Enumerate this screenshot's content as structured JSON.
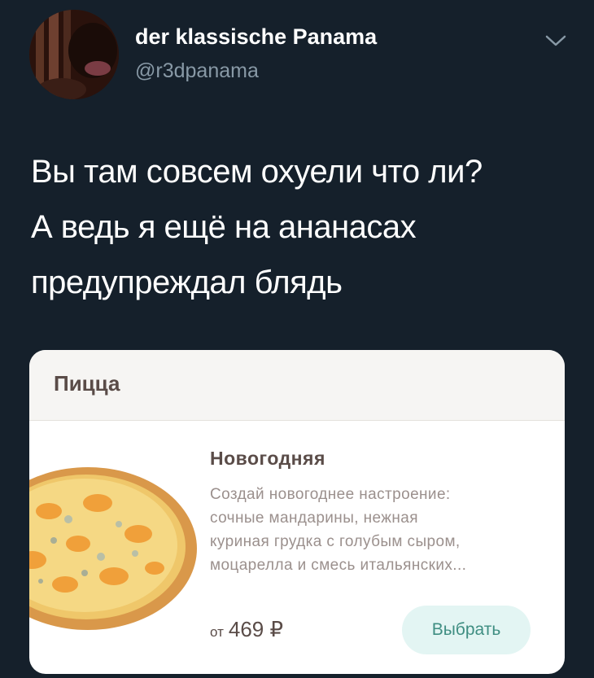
{
  "tweet": {
    "author": {
      "display_name": "der klassische Panama",
      "handle": "@r3dpanama"
    },
    "menu_icon": "chevron-down-icon",
    "text_lines": [
      "Вы там совсем охуели что ли?",
      "А ведь я ещё на ананасах",
      "предупреждал блядь"
    ]
  },
  "card": {
    "category": "Пицца",
    "product": {
      "name": "Новогодняя",
      "description_lines": [
        "Создай новогоднее настроение:",
        "сочные мандарины, нежная",
        "куриная грудка с голубым сыром,",
        "моцарелла и смесь итальянских..."
      ],
      "price_prefix": "от",
      "price": "469 ₽",
      "button_label": "Выбрать"
    }
  },
  "colors": {
    "background": "#15202b",
    "handle": "#8899a6",
    "button_bg": "#e3f5f3",
    "button_text": "#3f8e82"
  }
}
